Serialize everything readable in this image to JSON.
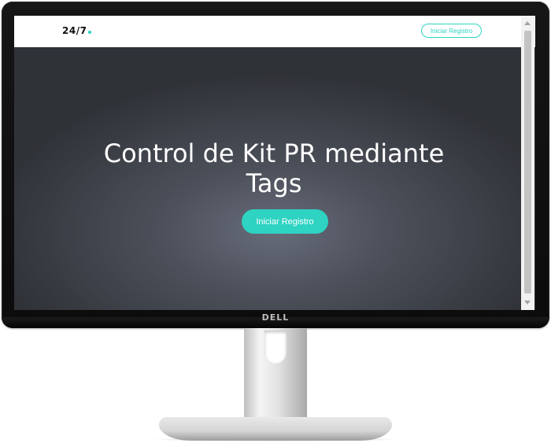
{
  "device": {
    "brand": "DELL"
  },
  "navbar": {
    "logo": "24/7",
    "cta_label": "Iniciar Registro"
  },
  "hero": {
    "title": "Control de Kit PR mediante Tags",
    "cta_label": "Iniciar Registro"
  },
  "colors": {
    "accent": "#2ed3c2",
    "hero_center": "#676c7a",
    "hero_edge": "#2f3237"
  },
  "icons": {
    "scroll_up": "triangle-up",
    "scroll_down": "triangle-down"
  }
}
